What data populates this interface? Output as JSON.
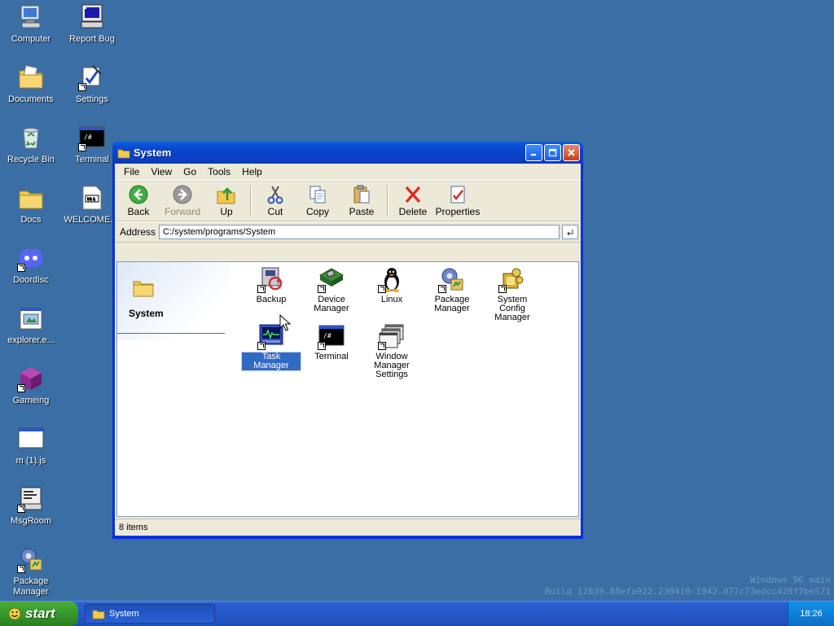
{
  "desktop": {
    "icons": [
      {
        "label": "Computer",
        "icon": "computer-icon"
      },
      {
        "label": "Report Bug",
        "icon": "report-bug-icon"
      },
      {
        "label": "Documents",
        "icon": "documents-folder-icon"
      },
      {
        "label": "Settings",
        "icon": "settings-icon"
      },
      {
        "label": "Recycle Bin",
        "icon": "recycle-bin-icon"
      },
      {
        "label": "Terminal",
        "icon": "terminal-icon"
      },
      {
        "label": "Docs",
        "icon": "folder-icon"
      },
      {
        "label": "WELCOME....",
        "icon": "markdown-file-icon"
      },
      {
        "label": "Doordisc",
        "icon": "doordisc-icon"
      },
      {
        "label": "explorer.e...",
        "icon": "exe-file-icon"
      },
      {
        "label": "Gameing",
        "icon": "game-cube-icon"
      },
      {
        "label": "m (1).js",
        "icon": "window-file-icon"
      },
      {
        "label": "MsgRoom",
        "icon": "msgroom-icon"
      },
      {
        "label": "Package Manager",
        "icon": "package-manager-icon"
      }
    ],
    "watermark": {
      "line1": "Windows 96 main",
      "line2": "Build 12839.88efa922.230410-1942.d77c73edcc428f7be571"
    }
  },
  "window": {
    "title": "System",
    "menu": [
      "File",
      "View",
      "Go",
      "Tools",
      "Help"
    ],
    "toolbar": {
      "back": "Back",
      "forward": "Forward",
      "up": "Up",
      "cut": "Cut",
      "copy": "Copy",
      "paste": "Paste",
      "delete": "Delete",
      "properties": "Properties"
    },
    "address": {
      "label": "Address",
      "value": "C:/system/programs/System"
    },
    "side_panel": {
      "title": "System"
    },
    "items": [
      {
        "label": "Backup",
        "icon": "backup-icon"
      },
      {
        "label": "Device Manager",
        "icon": "device-manager-icon"
      },
      {
        "label": "Linux",
        "icon": "linux-penguin-icon"
      },
      {
        "label": "Package Manager",
        "icon": "package-manager-icon"
      },
      {
        "label": "System Config Manager",
        "icon": "system-config-icon"
      },
      {
        "label": "Task Manager",
        "icon": "task-manager-icon",
        "selected": true
      },
      {
        "label": "Terminal",
        "icon": "terminal-icon"
      },
      {
        "label": "Window Manager Settings",
        "icon": "window-manager-icon"
      }
    ],
    "status": "8 items"
  },
  "taskbar": {
    "start_label": "start",
    "task_label": "System",
    "clock": "18:26"
  },
  "colors": {
    "desktop": "#3a6ea5",
    "titlebar": "#0a4fd6",
    "selection": "#316ac5",
    "start": "#3a9b2e"
  }
}
